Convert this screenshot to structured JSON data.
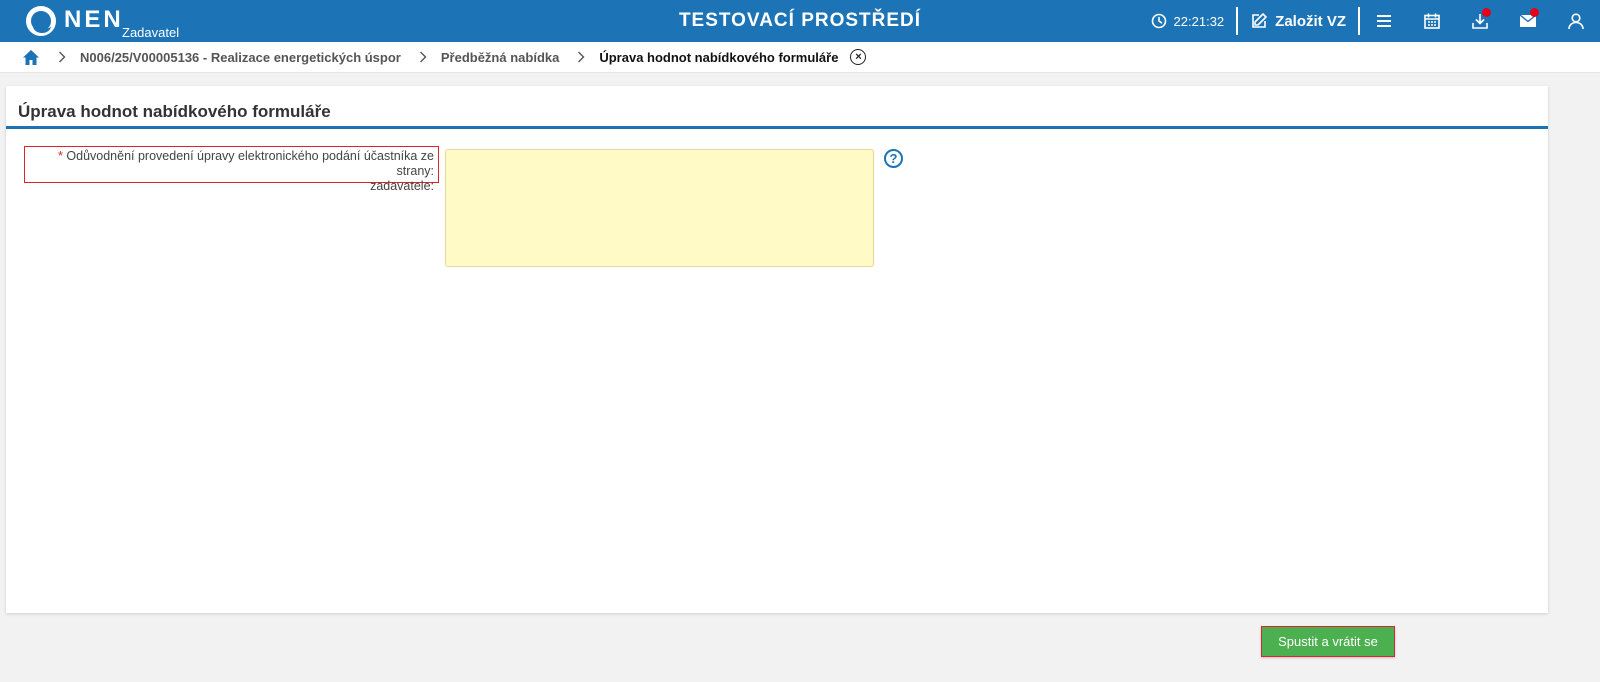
{
  "header": {
    "logo_text": "NEN",
    "logo_sub": "Zadavatel",
    "environment_title": "TESTOVACÍ PROSTŘEDÍ",
    "clock_time": "22:21:32",
    "create_label": "Založit VZ",
    "icons": [
      "menu-icon",
      "calendar-icon",
      "download-icon",
      "mail-icon",
      "user-icon"
    ],
    "accent_color": "#1c74b6",
    "badge_color": "#e2001a"
  },
  "breadcrumb": {
    "items": [
      "N006/25/V00005136 - Realizace energetických úspor",
      "Předběžná nabídka",
      "Úprava hodnot nabídkového formuláře"
    ],
    "close_symbol": "×"
  },
  "panel": {
    "title": "Úprava hodnot nabídkového formuláře",
    "field": {
      "required_mark": "*",
      "label_line1": "Odůvodnění provedení úpravy elektronického podání účastníka ze strany:",
      "label_line2": "zadavatele:",
      "value": "",
      "help_symbol": "?"
    }
  },
  "actions": {
    "run_and_return_label": "Spustit a vrátit se",
    "button_color": "#4caf50"
  }
}
